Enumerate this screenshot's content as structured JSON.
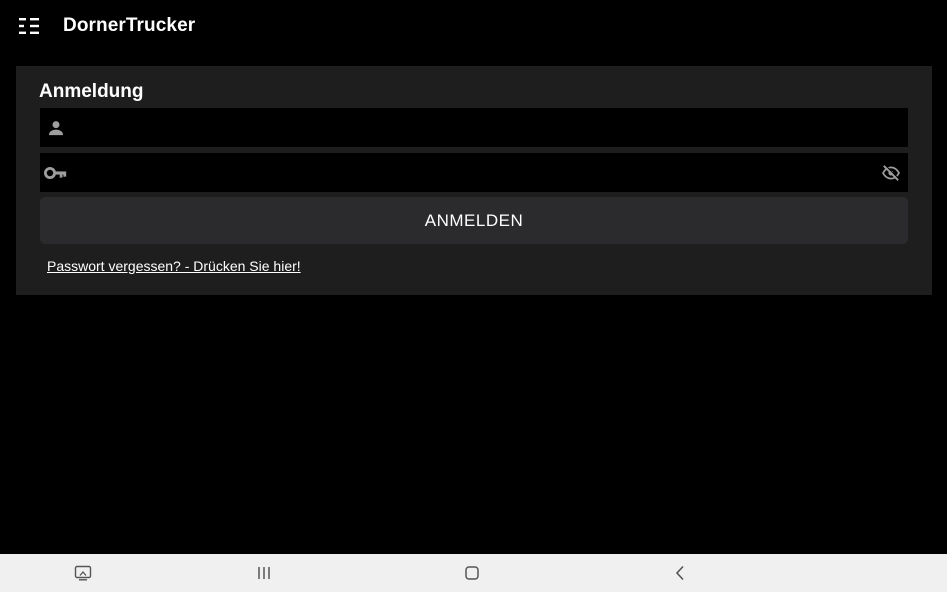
{
  "app": {
    "title": "DornerTrucker",
    "menu_icon": "menu-icon"
  },
  "login": {
    "title": "Anmeldung",
    "username": {
      "value": "",
      "placeholder": "",
      "icon": "person-icon"
    },
    "password": {
      "value": "",
      "placeholder": "",
      "icon": "key-icon",
      "toggle_icon": "eye-off-icon"
    },
    "submit_label": "ANMELDEN",
    "forgot_link": "Passwort vergessen? - Drücken Sie hier!"
  },
  "system_nav": {
    "buttons": [
      "screenshot-icon",
      "recents-icon",
      "home-icon",
      "back-icon"
    ]
  },
  "colors": {
    "background": "#000000",
    "card": "#1e1e1f",
    "button": "#2b2b2d",
    "navbar": "#f0f0f0"
  }
}
